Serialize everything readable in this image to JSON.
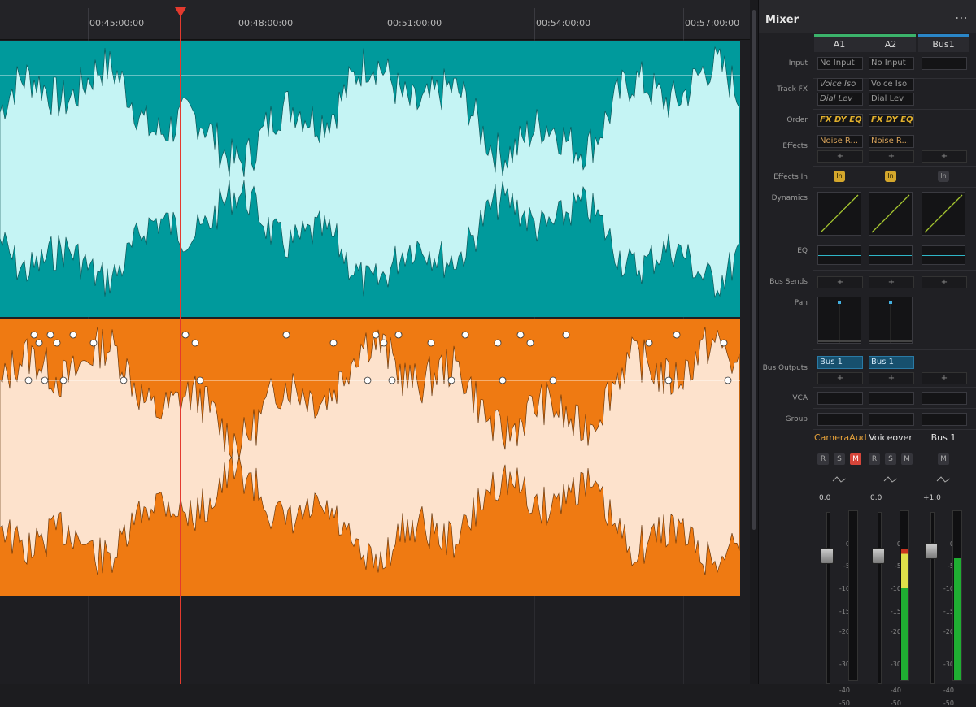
{
  "timeline": {
    "timecodes": [
      "00:45:00:00",
      "00:48:00:00",
      "00:51:00:00",
      "00:54:00:00",
      "00:57:00:00"
    ],
    "track1_color": "#009a9c",
    "track2_color": "#ef7a12"
  },
  "mixer": {
    "title": "Mixer",
    "more_icon": "⋯",
    "row_labels": {
      "input": "Input",
      "track_fx": "Track FX",
      "order": "Order",
      "effects": "Effects",
      "effects_in": "Effects In",
      "dynamics": "Dynamics",
      "eq": "EQ",
      "bus_sends": "Bus Sends",
      "pan": "Pan",
      "bus_outputs": "Bus Outputs",
      "vca": "VCA",
      "group": "Group"
    },
    "channels": [
      {
        "header": "A1",
        "header_color": "#3bb36b",
        "input": "No Input",
        "track_fx": [
          "Voice Iso",
          "Dial Lev"
        ],
        "order": "FX DY EQ",
        "effect": "Noise R...",
        "plus": "+",
        "effects_in": "In",
        "bus_sends_plus": "+",
        "bus_output": "Bus 1",
        "bus_output_plus": "+",
        "name": "CameraAud",
        "name_color": "#e8a33a",
        "r": "R",
        "s": "S",
        "m": "M",
        "gain": "0.0",
        "meter_level": 0
      },
      {
        "header": "A2",
        "header_color": "#3bb36b",
        "input": "No Input",
        "track_fx": [
          "Voice Iso",
          "Dial Lev"
        ],
        "order": "FX DY EQ",
        "effect": "Noise R...",
        "plus": "+",
        "effects_in": "In",
        "bus_sends_plus": "+",
        "bus_output": "Bus 1",
        "bus_output_plus": "+",
        "name": "Voiceover",
        "name_color": "#e6e6e6",
        "r": "R",
        "s": "S",
        "m": "M",
        "gain": "0.0",
        "meter_level": 0.78
      },
      {
        "header": "Bus1",
        "header_color": "#2a86c8",
        "input": "",
        "track_fx": [],
        "order": "",
        "effect": "",
        "plus": "+",
        "effects_in": "In",
        "bus_sends_plus": "+",
        "bus_output": "",
        "bus_output_plus": "+",
        "name": "Bus 1",
        "name_color": "#e6e6e6",
        "m": "M",
        "gain": "+1.0",
        "meter_level": 0.72
      }
    ],
    "fader_scale": [
      "0",
      "-5",
      "-10",
      "-15",
      "-20",
      "-30",
      "-40",
      "-50"
    ]
  }
}
